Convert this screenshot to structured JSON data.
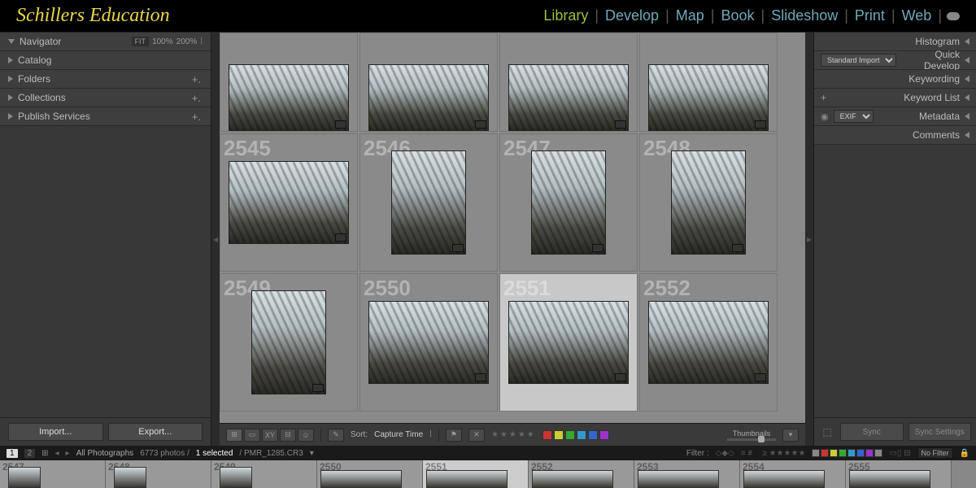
{
  "brand": "Schillers Education",
  "modules": [
    "Library",
    "Develop",
    "Map",
    "Book",
    "Slideshow",
    "Print",
    "Web"
  ],
  "active_module": "Library",
  "left": {
    "navigator": {
      "label": "Navigator",
      "badges": [
        "FIT",
        "100%",
        "200%"
      ]
    },
    "catalog": "Catalog",
    "folders": "Folders",
    "collections": "Collections",
    "publish": "Publish Services",
    "import": "Import...",
    "export": "Export..."
  },
  "right": {
    "histogram": "Histogram",
    "quickdev": "Quick Develop",
    "quickdev_preset": "Standard Import",
    "keywording": "Keywording",
    "keywordlist": "Keyword List",
    "metadata": "Metadata",
    "metadata_preset": "EXIF",
    "comments": "Comments",
    "sync": "Sync",
    "sync_settings": "Sync Settings"
  },
  "grid": {
    "selected_seq": "2551",
    "cells": [
      {
        "orient": "landscape",
        "partial": true
      },
      {
        "orient": "landscape",
        "partial": true
      },
      {
        "orient": "landscape",
        "partial": true
      },
      {
        "orient": "landscape",
        "partial": true
      },
      {
        "seq": "2545",
        "orient": "landscape"
      },
      {
        "seq": "2546",
        "orient": "portrait"
      },
      {
        "seq": "2547",
        "orient": "portrait"
      },
      {
        "seq": "2548",
        "orient": "portrait"
      },
      {
        "seq": "2549",
        "orient": "portrait"
      },
      {
        "seq": "2550",
        "orient": "landscape"
      },
      {
        "seq": "2551",
        "orient": "landscape",
        "selected": true
      },
      {
        "seq": "2552",
        "orient": "landscape"
      }
    ]
  },
  "toolbar": {
    "sort_label": "Sort:",
    "sort_value": "Capture Time",
    "thumb_label": "Thumbnails",
    "colors": [
      "#c33",
      "#cc3",
      "#3a3",
      "#39c",
      "#36c",
      "#93c"
    ]
  },
  "filterbar": {
    "page_current": "1",
    "page_other": "2",
    "source": "All Photographs",
    "count_text": "6773 photos /",
    "selected_text": "1 selected",
    "filename": "/ PMR_1285.CR3",
    "filter_label": "Filter :",
    "nofilter": "No Filter",
    "chip_colors": [
      "#888",
      "#c33",
      "#cc3",
      "#3a3",
      "#39c",
      "#36c",
      "#93c",
      "#888"
    ]
  },
  "filmstrip": {
    "items": [
      {
        "idx": "2547",
        "orient": "portrait"
      },
      {
        "idx": "2548",
        "orient": "portrait"
      },
      {
        "idx": "2549",
        "orient": "portrait"
      },
      {
        "idx": "2550",
        "orient": "landscape"
      },
      {
        "idx": "2551",
        "orient": "landscape",
        "selected": true
      },
      {
        "idx": "2552",
        "orient": "landscape"
      },
      {
        "idx": "2553",
        "orient": "landscape"
      },
      {
        "idx": "2554",
        "orient": "landscape"
      },
      {
        "idx": "2555",
        "orient": "landscape"
      }
    ]
  }
}
